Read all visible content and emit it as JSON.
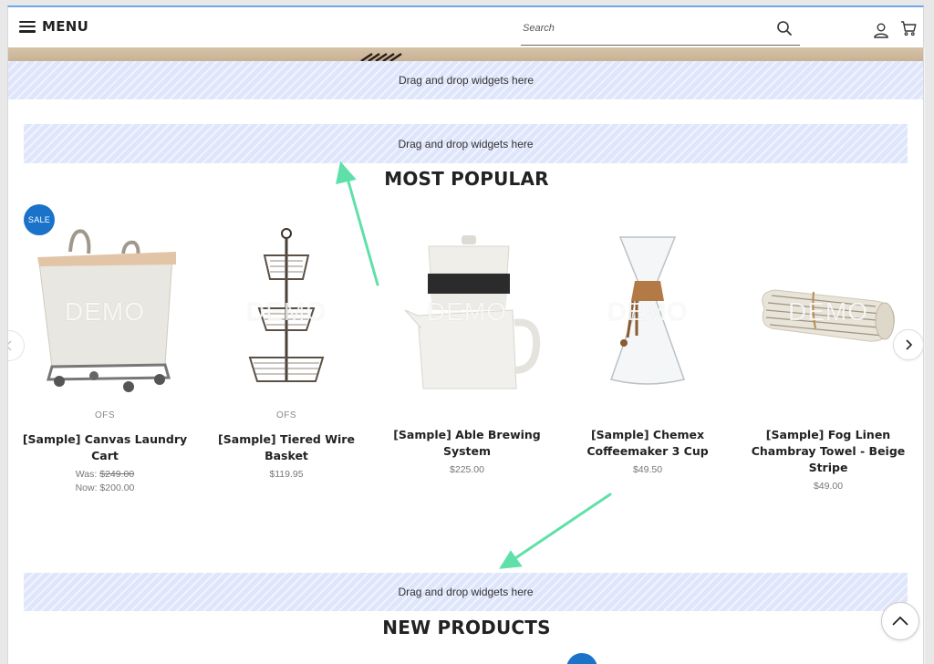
{
  "header": {
    "menu_label": "MENU",
    "search_placeholder": "Search"
  },
  "dropzone_text": "Drag and drop widgets here",
  "sections": {
    "most_popular": "MOST POPULAR",
    "new_products": "NEW PRODUCTS"
  },
  "watermark": "DEMO",
  "badge": {
    "sale": "SALE",
    "color": "#1a73c9"
  },
  "products": [
    {
      "brand": "OFS",
      "name": "[Sample] Canvas Laundry Cart",
      "was_label": "Was:",
      "was_price": "$249.00",
      "now": "Now: $200.00",
      "image": "laundry-cart"
    },
    {
      "brand": "OFS",
      "name": "[Sample] Tiered Wire Basket",
      "price": "$119.95",
      "image": "wire-basket"
    },
    {
      "brand": "",
      "name": "[Sample] Able Brewing System",
      "price": "$225.00",
      "image": "brewing-system"
    },
    {
      "brand": "",
      "name": "[Sample] Chemex Coffeemaker 3 Cup",
      "price": "$49.50",
      "image": "chemex"
    },
    {
      "brand": "",
      "name": "[Sample] Fog Linen Chambray Towel - Beige Stripe",
      "price": "$49.00",
      "image": "towel"
    }
  ],
  "colors": {
    "dropzone": "#dfe6fb",
    "annotation_arrow": "#5fe0a8"
  }
}
